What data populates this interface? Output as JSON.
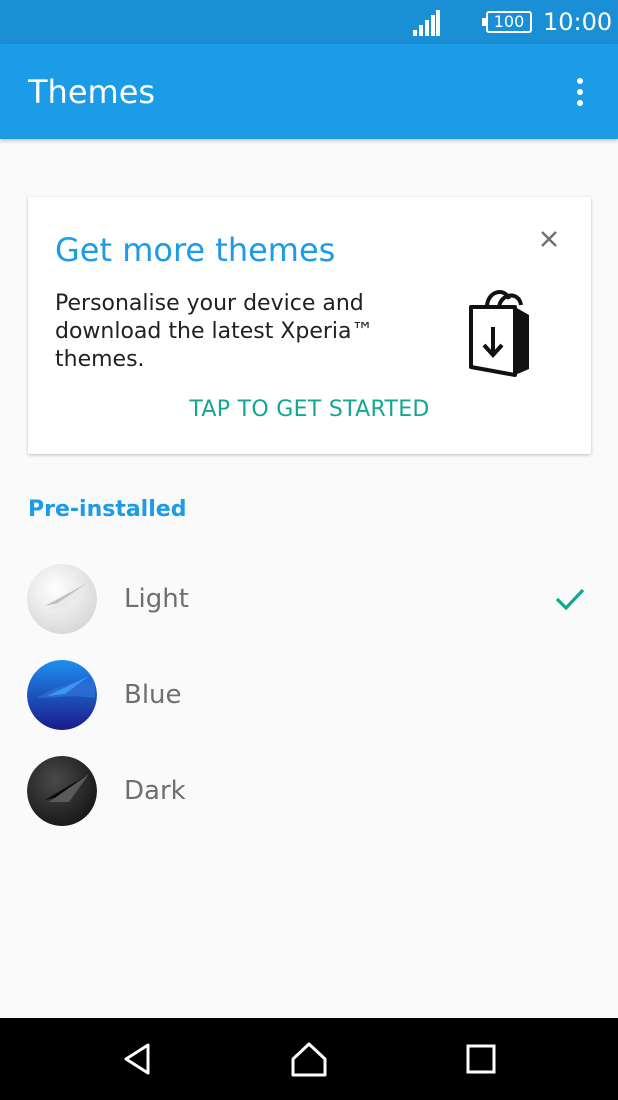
{
  "status_bar": {
    "battery": "100",
    "time": "10:00",
    "icons": [
      "signal-icon",
      "battery-icon"
    ]
  },
  "app_bar": {
    "title": "Themes",
    "overflow_icon": "more-vert-icon"
  },
  "promo": {
    "heading": "Get more themes",
    "description": "Personalise your device and download the latest Xperia™ themes.",
    "cta": "TAP TO GET STARTED",
    "close_icon": "close-icon",
    "illustration_icon": "shopping-bag-download-icon"
  },
  "section": {
    "label": "Pre-installed"
  },
  "themes": [
    {
      "name": "Light",
      "selected": true
    },
    {
      "name": "Blue",
      "selected": false
    },
    {
      "name": "Dark",
      "selected": false
    }
  ],
  "nav_bar": {
    "icons": [
      "back-icon",
      "home-icon",
      "recents-icon"
    ]
  },
  "colors": {
    "status_bar": "#1b8fd6",
    "app_bar": "#1c9be6",
    "accent_blue": "#1c9be6",
    "accent_green": "#14a68f",
    "background": "#fafafa"
  }
}
